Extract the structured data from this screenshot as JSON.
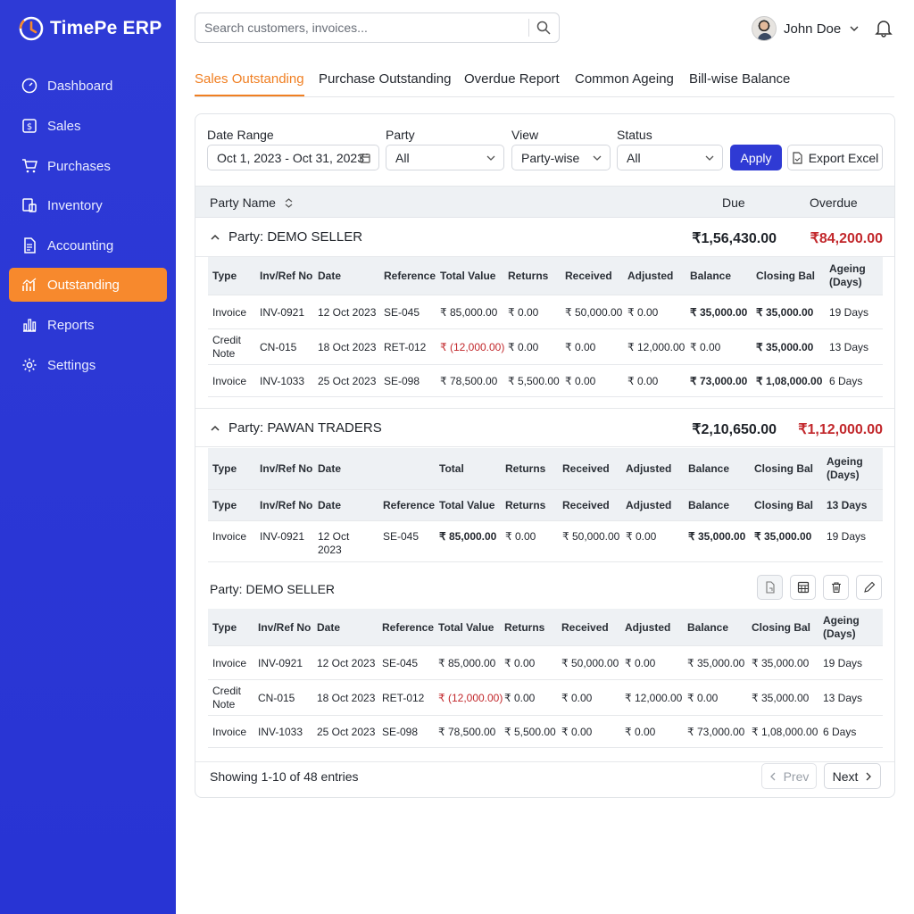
{
  "app": {
    "title": "TimePe ERP"
  },
  "sidebar": {
    "items": [
      {
        "label": "Dashboard",
        "icon": "dashboard-icon"
      },
      {
        "label": "Sales",
        "icon": "sales-icon"
      },
      {
        "label": "Purchases",
        "icon": "cart-icon"
      },
      {
        "label": "Inventory",
        "icon": "inventory-icon"
      },
      {
        "label": "Accounting",
        "icon": "document-icon"
      },
      {
        "label": "Outstanding",
        "icon": "chart-icon",
        "active": true
      },
      {
        "label": "Reports",
        "icon": "bar-chart-icon"
      },
      {
        "label": "Settings",
        "icon": "gear-icon"
      }
    ]
  },
  "header": {
    "search_placeholder": "Search customers, invoices...",
    "user_name": "John Doe"
  },
  "tabs": [
    "Sales Outstanding",
    "Purchase Outstanding",
    "Overdue Report",
    "Common Ageing",
    "Bill-wise Balance"
  ],
  "filters": {
    "date_label": "Date Range",
    "date_value": "Oct 1, 2023 - Oct 31, 2023",
    "party_label": "Party",
    "party_value": "All",
    "view_label": "View",
    "view_value": "Party-wise",
    "status_label": "Status",
    "status_value": "All",
    "apply_label": "Apply",
    "export_label": "Export Excel"
  },
  "table_header": {
    "party_name": "Party Name",
    "due": "Due",
    "overdue": "Overdue"
  },
  "col_headers": [
    "Type",
    "Inv/Ref No",
    "Date",
    "Reference",
    "Total Value",
    "Returns",
    "Received",
    "Adjusted",
    "Balance",
    "Closing Bal",
    "Ageing (Days)"
  ],
  "group1": {
    "title": "Party: DEMO SELLER",
    "due": "₹1,56,430.00",
    "overdue": "₹84,200.00",
    "rows": [
      [
        "Invoice",
        "INV-0921",
        "12 Oct 2023",
        "SE-045",
        "₹ 85,000.00",
        "₹ 0.00",
        "₹ 50,000.00",
        "₹ 0.00",
        "₹ 35,000.00",
        "₹ 35,000.00",
        "19 Days"
      ],
      [
        "Credit Note",
        "CN-015",
        "18 Oct 2023",
        "RET-012",
        "₹ (12,000.00)",
        "₹ 0.00",
        "₹ 0.00",
        "₹ 12,000.00",
        "₹ 0.00",
        "₹ 35,000.00",
        "13 Days"
      ],
      [
        "Invoice",
        "INV-1033",
        "25 Oct 2023",
        "SE-098",
        "₹ 78,500.00",
        "₹ 5,500.00",
        "₹ 0.00",
        "₹ 0.00",
        "₹ 73,000.00",
        "₹ 1,08,000.00",
        "6 Days"
      ]
    ]
  },
  "group2": {
    "title": "Party: PAWAN TRADERS",
    "due": "₹2,10,650.00",
    "overdue": "₹1,12,000.00",
    "header1": [
      "Type",
      "Inv/Ref No",
      "Date",
      "Total",
      "Returns",
      "Received",
      "Adjusted",
      "Balance",
      "Closing Bal",
      "Ageing (Days)"
    ],
    "header2": [
      "Type",
      "Inv/Ref No",
      "Date",
      "Reference",
      "Total Value",
      "Returns",
      "Received",
      "Adjusted",
      "Balance",
      "Closing Bal",
      "13 Days"
    ],
    "row": [
      "Invoice",
      "INV-0921",
      "12 Oct 2023",
      "SE-045",
      "₹ 85,000.00",
      "₹ 0.00",
      "₹ 50,000.00",
      "₹ 0.00",
      "₹ 35,000.00",
      "₹ 35,000.00",
      "19 Days"
    ]
  },
  "group3": {
    "title": "Party: DEMO SELLER",
    "rows": [
      [
        "Invoice",
        "INV-0921",
        "12 Oct 2023",
        "SE-045",
        "₹ 85,000.00",
        "₹ 0.00",
        "₹ 50,000.00",
        "₹ 0.00",
        "₹ 35,000.00",
        "₹ 35,000.00",
        "19 Days"
      ],
      [
        "Credit Note",
        "CN-015",
        "18 Oct 2023",
        "RET-012",
        "₹ (12,000.00)",
        "₹ 0.00",
        "₹ 0.00",
        "₹ 12,000.00",
        "₹ 0.00",
        "₹ 35,000.00",
        "13 Days"
      ],
      [
        "Invoice",
        "INV-1033",
        "25 Oct 2023",
        "SE-098",
        "₹ 78,500.00",
        "₹ 5,500.00",
        "₹ 0.00",
        "₹ 0.00",
        "₹ 73,000.00",
        "₹ 1,08,000.00",
        "6 Days"
      ]
    ]
  },
  "footer": {
    "info": "Showing 1-10 of 48 entries",
    "prev": "Prev",
    "next": "Next"
  },
  "colors": {
    "primary": "#2f3ad4",
    "accent": "#f7892d",
    "overdue": "#c2282c"
  }
}
